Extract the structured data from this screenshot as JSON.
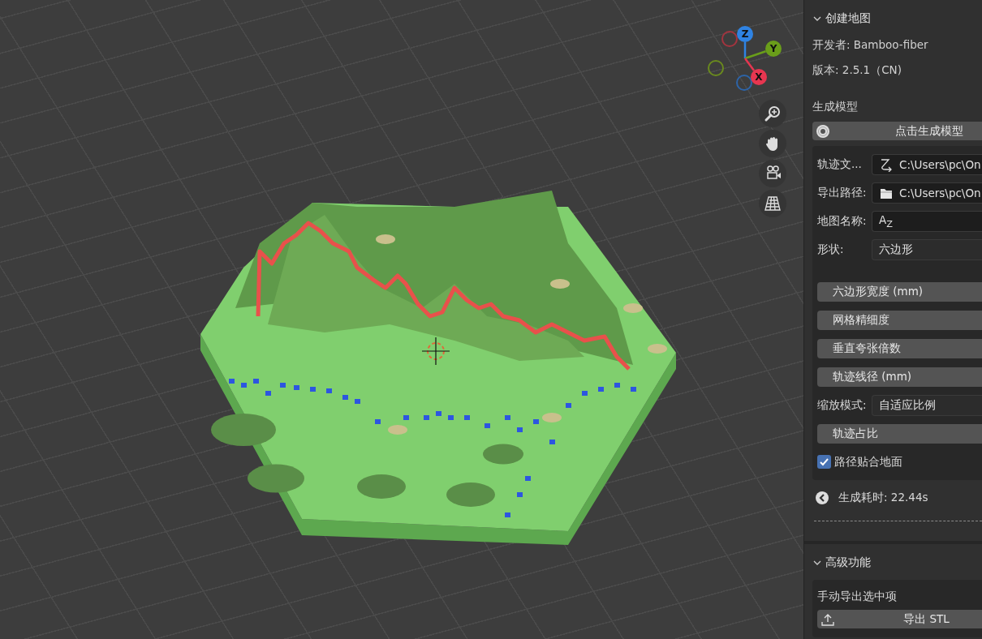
{
  "viewport": {
    "gizmo": [
      {
        "kind": "negative",
        "color": "#a3343f"
      },
      {
        "kind": "negative",
        "color": "#6a8a1e"
      },
      {
        "kind": "negative",
        "color": "#2d64a8"
      },
      {
        "kind": "positive",
        "label": "Z",
        "color": "#2f83e3"
      },
      {
        "kind": "positive",
        "label": "Y",
        "color": "#6a9e1a"
      },
      {
        "kind": "positive",
        "label": "X",
        "color": "#e63650"
      }
    ],
    "nav_buttons": [
      {
        "kind": "zoom"
      },
      {
        "kind": "pan"
      },
      {
        "kind": "camera"
      },
      {
        "kind": "grid"
      }
    ]
  },
  "panel": {
    "sections": [
      {
        "title": "创建地图",
        "expanded": true,
        "items": [
          {
            "kind": "info",
            "text": "开发者: Bamboo-fiber"
          },
          {
            "kind": "info",
            "text": "版本: 2.5.1（CN)"
          },
          {
            "kind": "heading",
            "text": "生成模型"
          },
          {
            "kind": "generate_button",
            "label": "点击生成模型"
          },
          {
            "kind": "group",
            "rows": [
              {
                "kind": "file_field",
                "label": "轨迹文...",
                "value": "C:\\Users\\pc\\On"
              },
              {
                "kind": "folder_field",
                "label": "导出路径:",
                "value": "C:\\Users\\pc\\On"
              },
              {
                "kind": "text_field",
                "label": "地图名称:",
                "value": "A$_{Z}$"
              },
              {
                "kind": "dropdown",
                "label": "形状:",
                "value": "六边形"
              },
              {
                "kind": "number",
                "label": "六边形宽度 (mm)"
              },
              {
                "kind": "number",
                "label": "网格精细度"
              },
              {
                "kind": "number",
                "label": "垂直夸张倍数"
              },
              {
                "kind": "number",
                "label": "轨迹线径 (mm)"
              },
              {
                "kind": "dropdown",
                "label": "缩放模式:",
                "value": "自适应比例"
              },
              {
                "kind": "number",
                "label": "轨迹占比"
              },
              {
                "kind": "checkbox",
                "label": "路径贴合地面",
                "checked": true
              }
            ]
          },
          {
            "kind": "status",
            "text": "生成耗时: 22.44s"
          }
        ]
      },
      {
        "title": "高级功能",
        "expanded": true,
        "items": [
          {
            "kind": "group",
            "rows": [
              {
                "kind": "heading",
                "label": "手动导出选中项"
              },
              {
                "kind": "export_button",
                "label": "导出 STL"
              }
            ]
          }
        ]
      }
    ]
  }
}
